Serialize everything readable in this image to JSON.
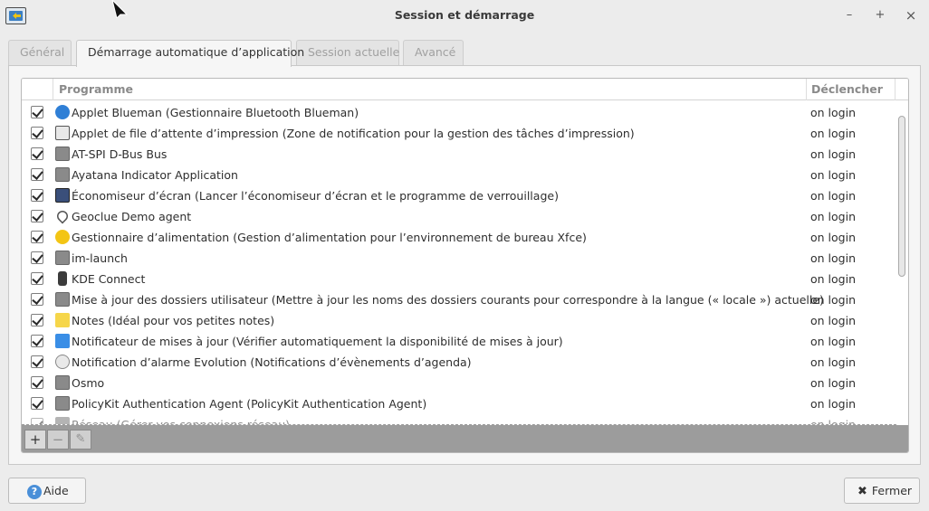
{
  "window": {
    "title": "Session et démarrage",
    "controls": {
      "minimize": "–",
      "maximize": "+",
      "close": "×"
    }
  },
  "tabs": [
    {
      "label": "Général",
      "active": false
    },
    {
      "label": "Démarrage automatique d’application",
      "active": true
    },
    {
      "label": "Session actuelle",
      "active": false
    },
    {
      "label": "Avancé",
      "active": false
    }
  ],
  "list": {
    "headers": {
      "program": "Programme",
      "trigger": "Déclencher"
    },
    "rows": [
      {
        "name": "Applet Blueman (Gestionnaire Bluetooth Blueman)",
        "trigger": "on login",
        "checked": true,
        "icon": "bluetooth-icon"
      },
      {
        "name": "Applet de file d’attente d’impression (Zone de notification pour la gestion des tâches d’impression)",
        "trigger": "on login",
        "checked": true,
        "icon": "printer-icon"
      },
      {
        "name": "AT-SPI D-Bus Bus",
        "trigger": "on login",
        "checked": true,
        "icon": "gear-icon"
      },
      {
        "name": "Ayatana Indicator Application",
        "trigger": "on login",
        "checked": true,
        "icon": "gear-icon"
      },
      {
        "name": "Économiseur d’écran (Lancer l’économiseur d’écran et le programme de verrouillage)",
        "trigger": "on login",
        "checked": true,
        "icon": "monitor-icon"
      },
      {
        "name": "Geoclue Demo agent",
        "trigger": "on login",
        "checked": true,
        "icon": "location-pin-icon"
      },
      {
        "name": "Gestionnaire d’alimentation (Gestion d’alimentation pour l’environnement de bureau Xfce)",
        "trigger": "on login",
        "checked": true,
        "icon": "power-icon"
      },
      {
        "name": "im-launch",
        "trigger": "on login",
        "checked": true,
        "icon": "gear-icon"
      },
      {
        "name": "KDE Connect",
        "trigger": "on login",
        "checked": true,
        "icon": "phone-icon"
      },
      {
        "name": "Mise à jour des dossiers utilisateur (Mettre à jour les noms des dossiers courants pour correspondre à la langue (« locale ») actuelle)",
        "trigger": "on login",
        "checked": true,
        "icon": "gear-icon"
      },
      {
        "name": "Notes (Idéal pour vos petites notes)",
        "trigger": "on login",
        "checked": true,
        "icon": "notes-icon"
      },
      {
        "name": "Notificateur de mises à jour (Vérifier automatiquement la disponibilité de mises à jour)",
        "trigger": "on login",
        "checked": true,
        "icon": "update-icon"
      },
      {
        "name": "Notification d’alarme Evolution (Notifications d’évènements d’agenda)",
        "trigger": "on login",
        "checked": true,
        "icon": "alarm-icon"
      },
      {
        "name": "Osmo",
        "trigger": "on login",
        "checked": true,
        "icon": "gear-icon"
      },
      {
        "name": "PolicyKit Authentication Agent (PolicyKit Authentication Agent)",
        "trigger": "on login",
        "checked": true,
        "icon": "gear-icon"
      },
      {
        "name": "Réseau (Gérer vos connexions réseau)",
        "trigger": "on login",
        "checked": true,
        "icon": "network-icon"
      }
    ]
  },
  "toolbar": {
    "add": "+",
    "remove": "−",
    "edit": "✎"
  },
  "buttons": {
    "help": "Aide",
    "close": "Fermer"
  },
  "colors": {
    "bluetooth": "#2f7fd6",
    "power": "#f3c515",
    "notes": "#f6d64a",
    "update": "#3a8ee6",
    "gear": "#8a8a8a"
  }
}
